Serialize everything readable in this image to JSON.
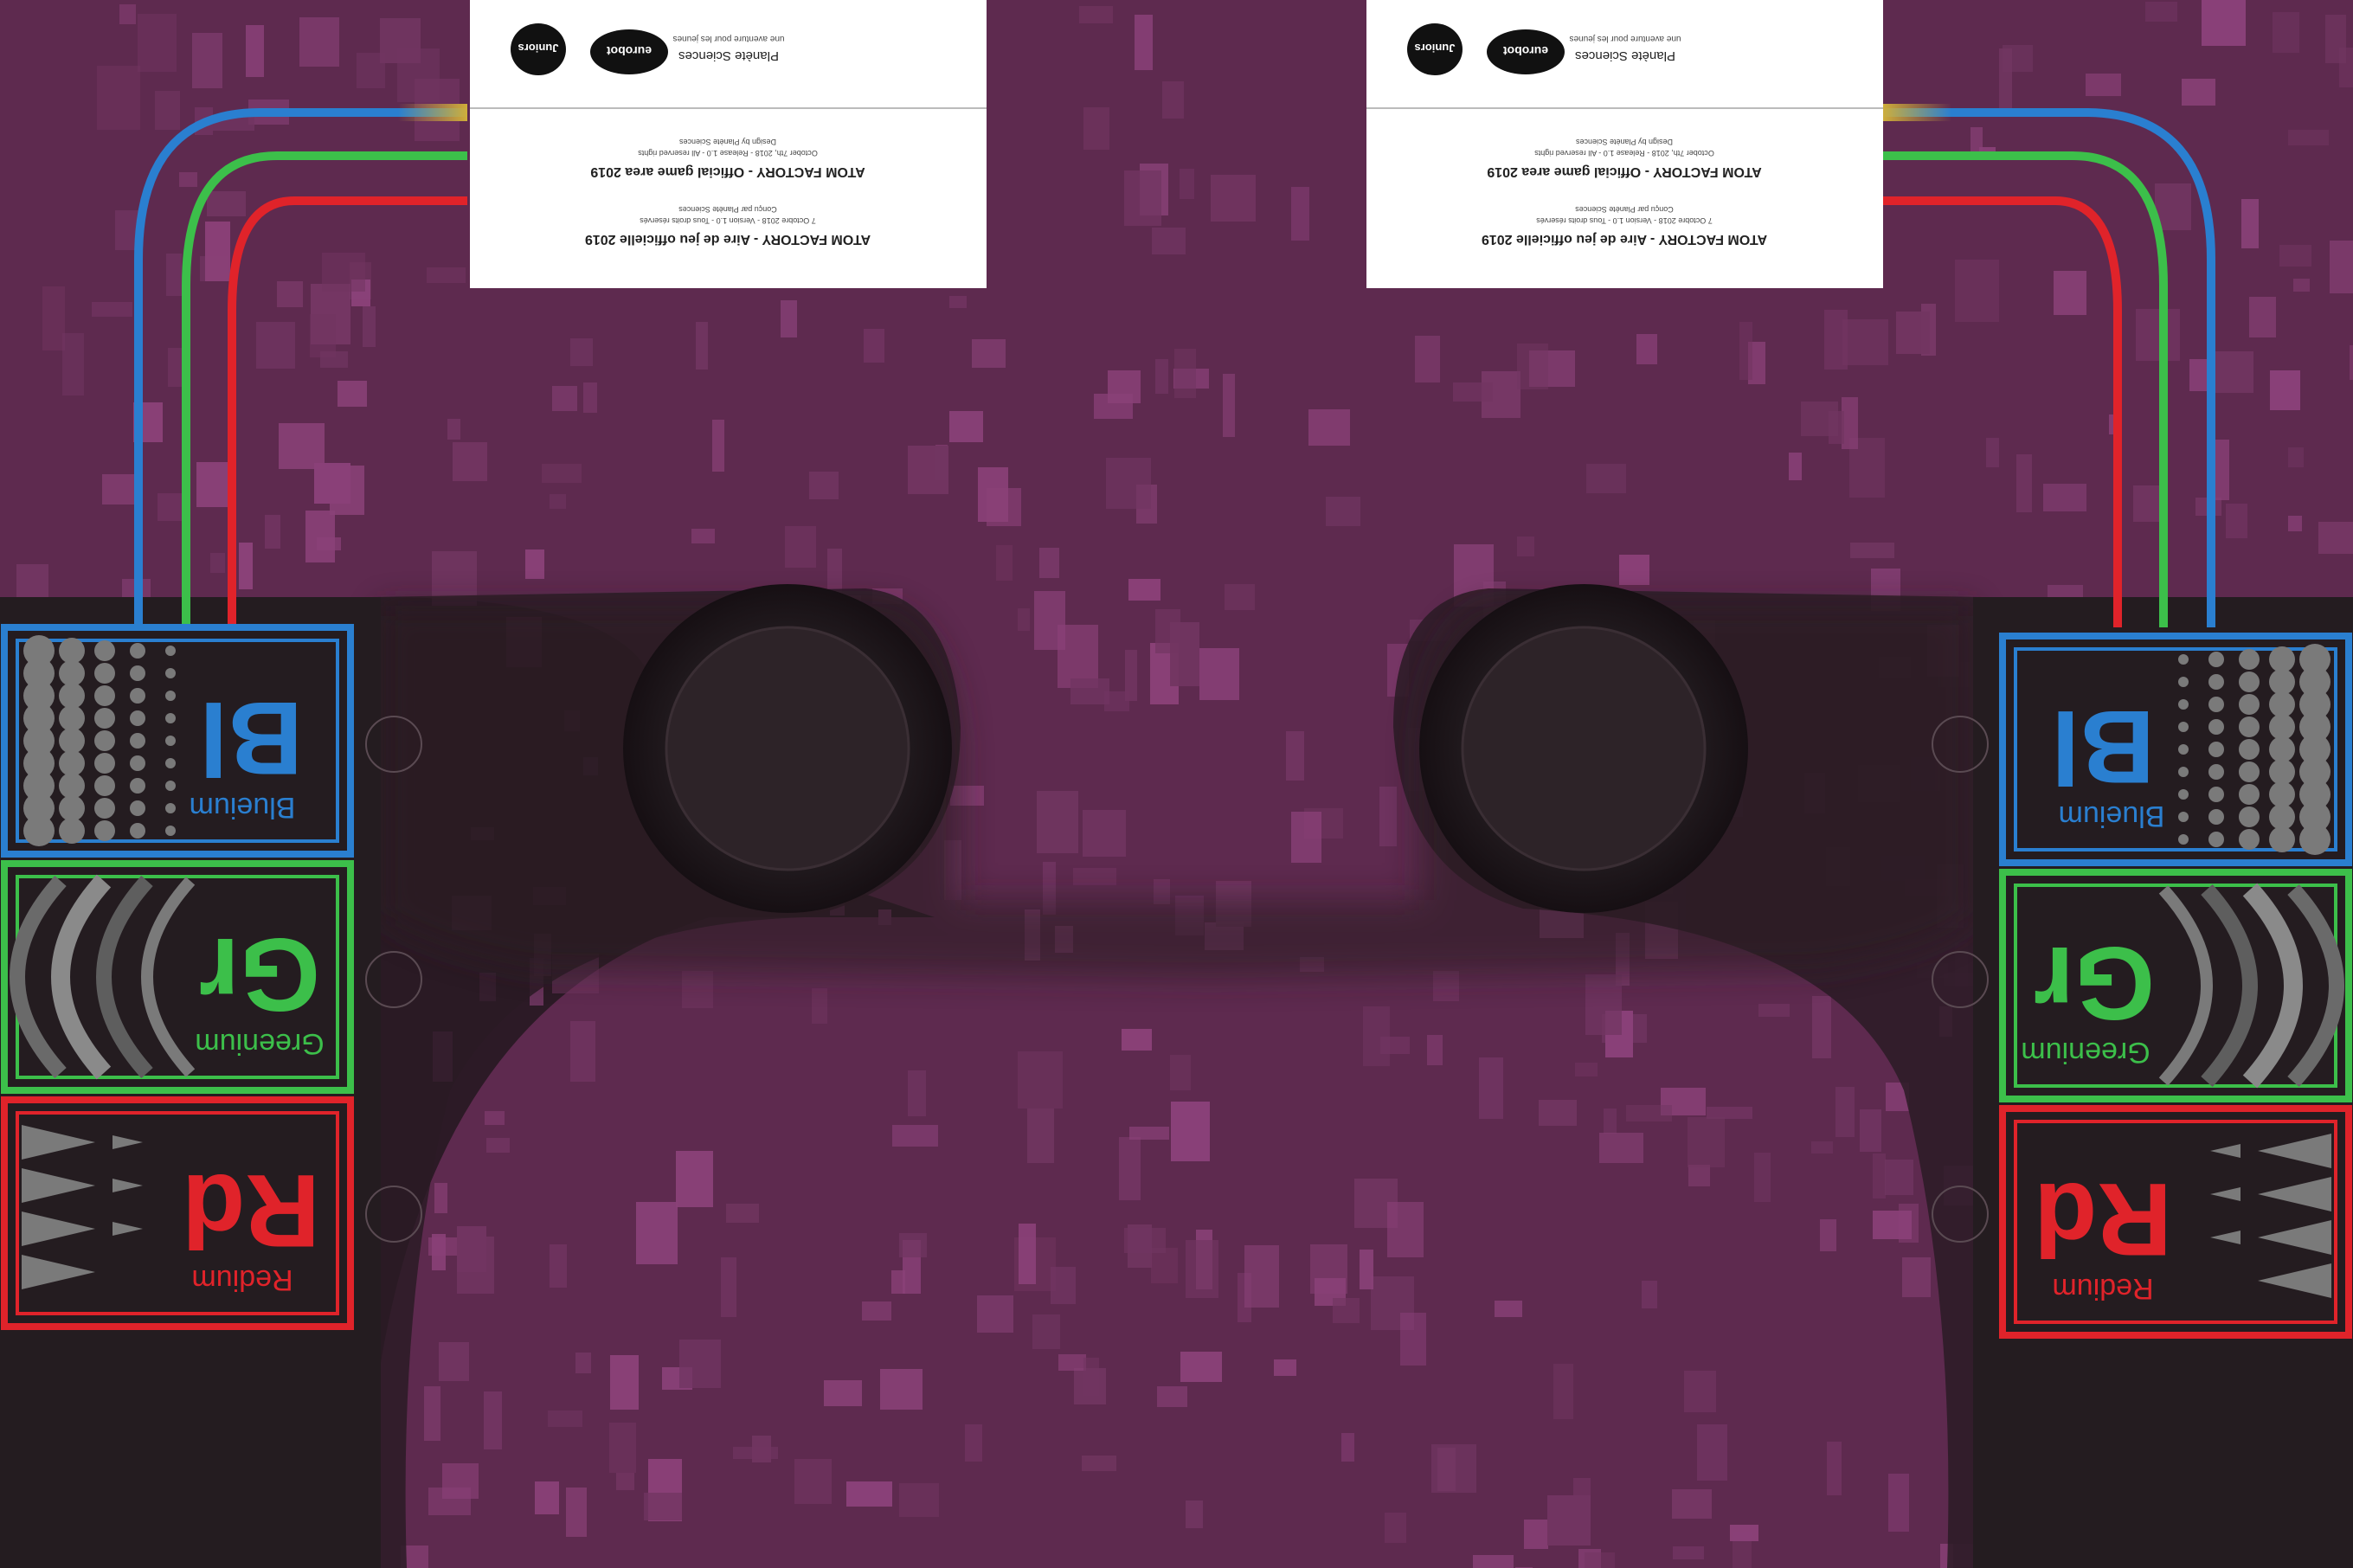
{
  "colors": {
    "background": "#2c1a26",
    "purple_zone": "#5e2a4f",
    "pixel_square": "#8a4178",
    "dark_area": "#2a1b24",
    "blue": "#2a7fd0",
    "green": "#3cbf4a",
    "red": "#e0232a",
    "panel_dark": "#241c20",
    "gray": "#7a7a7a"
  },
  "info_cards": [
    {
      "logos": [
        "Juniors",
        "eurobot",
        "Planète Sciences"
      ],
      "slogan": "une aventure pour les jeunes",
      "title_en": "ATOM FACTORY - Official game area 2019",
      "credit_en": "October 7th, 2018 - Release 1.0 - All reserved rights",
      "design_en": "Design by Planète Sciences",
      "title_fr": "ATOM FACTORY - Aire de jeu officielle 2019",
      "credit_fr": "7 Octobre 2018 - Version 1.0 - Tous droits réservés",
      "design_fr": "Conçu par Planète Sciences"
    },
    {
      "logos": [
        "Juniors",
        "eurobot",
        "Planète Sciences"
      ],
      "slogan": "une aventure pour les jeunes",
      "title_en": "ATOM FACTORY - Official game area 2019",
      "credit_en": "October 7th, 2018 - Release 1.0 - All reserved rights",
      "design_en": "Design by Planète Sciences",
      "title_fr": "ATOM FACTORY - Aire de jeu officielle 2019",
      "credit_fr": "7 Octobre 2018 - Version 1.0 - Tous droits réservés",
      "design_fr": "Conçu par Planète Sciences"
    }
  ],
  "elements": [
    {
      "symbol": "Bl",
      "name": "Blueium",
      "color": "#2a7fd0"
    },
    {
      "symbol": "Gr",
      "name": "Greenium",
      "color": "#3cbf4a"
    },
    {
      "symbol": "Rd",
      "name": "Redium",
      "color": "#e0232a"
    }
  ]
}
